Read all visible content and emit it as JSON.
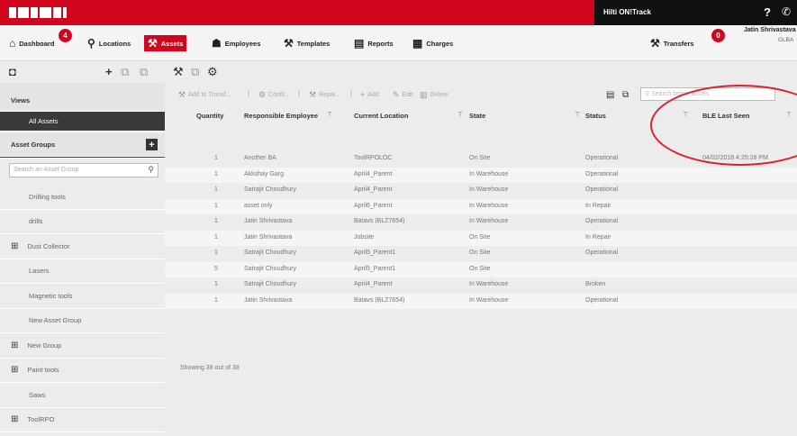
{
  "header": {
    "product_name": "Hilti ON!Track",
    "help_icon": "?",
    "phone_icon": "phone-icon"
  },
  "nav": {
    "dashboard": {
      "label": "Dashboard",
      "badge": "4"
    },
    "locations": {
      "label": "Locations"
    },
    "assets": {
      "label": "Assets"
    },
    "employees": {
      "label": "Employees"
    },
    "templates": {
      "label": "Templates"
    },
    "reports": {
      "label": "Reports"
    },
    "charges": {
      "label": "Charges"
    },
    "transfers": {
      "label": "Transfers",
      "badge": "0"
    },
    "user": {
      "name": "Jatin Shrivastava",
      "org": "GLBA"
    }
  },
  "sidebar": {
    "views_label": "Views",
    "all_assets_label": "All Assets",
    "asset_groups_label": "Asset Groups",
    "search_placeholder": "Search an Asset Group",
    "groups": [
      {
        "label": "Drilling tools",
        "expandable": false
      },
      {
        "label": "drills",
        "expandable": false
      },
      {
        "label": "Dust Collector",
        "expandable": true
      },
      {
        "label": "Lasers",
        "expandable": false
      },
      {
        "label": "Magnetic tools",
        "expandable": false
      },
      {
        "label": "New Asset Group",
        "expandable": false
      },
      {
        "label": "New Group",
        "expandable": true
      },
      {
        "label": "Paint tools",
        "expandable": true
      },
      {
        "label": "Saws",
        "expandable": false
      },
      {
        "label": "ToolRPO",
        "expandable": true
      }
    ]
  },
  "toolbar": {
    "add_to_transfer": "Add to Transf...",
    "confirm": "Confir...",
    "repair": "Repai...",
    "add": "Add",
    "edit": "Edit",
    "delete": "Delete",
    "search_placeholder": "Search below assets"
  },
  "table": {
    "columns": [
      "Quantity",
      "Responsible Employee",
      "Current Location",
      "State",
      "Status",
      "BLE Last Seen"
    ],
    "rows": [
      [
        "1",
        "Another BA",
        "ToolRPOLOC",
        "On Site",
        "Operational",
        "04/02/2018 4:25:28 PM"
      ],
      [
        "1",
        "Akkshay Garg",
        "April4_Parent",
        "In Warehouse",
        "Operational",
        ""
      ],
      [
        "1",
        "Satrajit Choudhury",
        "April4_Parent",
        "In Warehouse",
        "Operational",
        ""
      ],
      [
        "1",
        "asset only",
        "April6_Parent",
        "In Warehouse",
        "In Repair",
        ""
      ],
      [
        "1",
        "Jatin Shrivastava",
        "Batavs (BLZ7654)",
        "In Warehouse",
        "Operational",
        ""
      ],
      [
        "1",
        "Jatin Shrivastava",
        "Jobsite",
        "On Site",
        "In Repair",
        ""
      ],
      [
        "1",
        "Satrajit Choudhury",
        "April5_Parent1",
        "On Site",
        "Operational",
        ""
      ],
      [
        "5",
        "Satrajit Choudhury",
        "April5_Parent1",
        "On Site",
        "",
        ""
      ],
      [
        "1",
        "Satrajit Choudhury",
        "April4_Parent",
        "In Warehouse",
        "Broken",
        ""
      ],
      [
        "1",
        "Jatin Shrivastava",
        "Batavs (BLZ7654)",
        "In Warehouse",
        "Operational",
        ""
      ]
    ],
    "footer": "Showing 38 out of 38"
  }
}
